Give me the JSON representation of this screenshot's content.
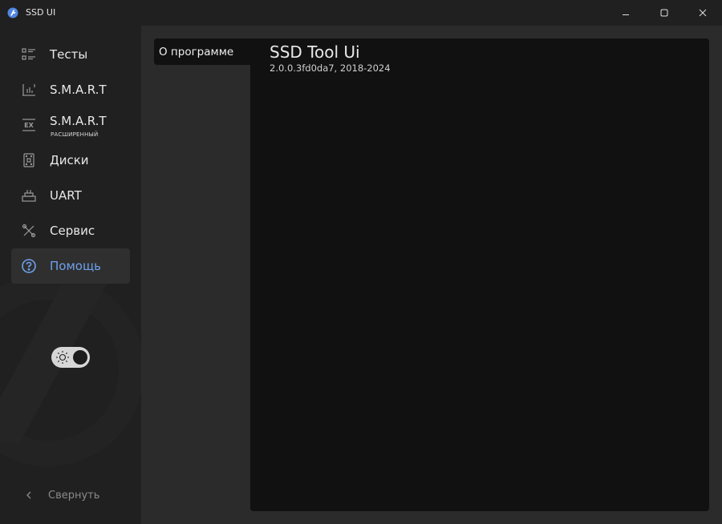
{
  "window": {
    "title": "SSD UI",
    "controls": [
      "minimize-icon",
      "maximize-icon",
      "close-icon"
    ]
  },
  "sidebar": {
    "items": [
      {
        "label": "Тесты",
        "icon": "list-icon",
        "active": false
      },
      {
        "label": "S.M.A.R.T",
        "icon": "chart-icon",
        "active": false
      },
      {
        "label": "S.M.A.R.T",
        "sublabel": "РАСШИРЕННЫЙ",
        "icon": "ex-icon",
        "active": false
      },
      {
        "label": "Диски",
        "icon": "disk-icon",
        "active": false
      },
      {
        "label": "UART",
        "icon": "uart-icon",
        "active": false
      },
      {
        "label": "Сервис",
        "icon": "tools-icon",
        "active": false
      },
      {
        "label": "Помощь",
        "icon": "help-icon",
        "active": true
      }
    ],
    "theme_toggle": {
      "icon": "sun-icon",
      "state": "dark"
    },
    "collapse_label": "Свернуть"
  },
  "main": {
    "tab_label": "О программе",
    "product_name": "SSD Tool Ui",
    "version": "2.0.0.3fd0da7, 2018-2024"
  },
  "colors": {
    "background": "#202020",
    "main_background": "#2b2b2b",
    "panel": "#111111",
    "accent": "#6ea0ec",
    "active_item": "#2f2f2f"
  }
}
